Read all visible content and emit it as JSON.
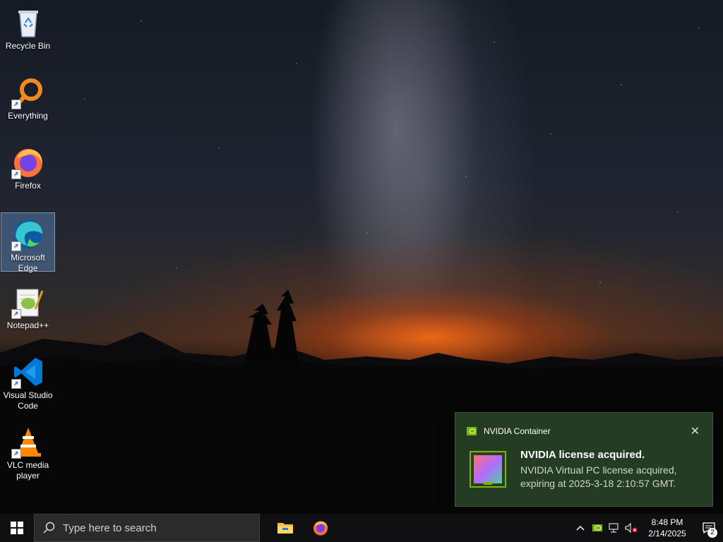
{
  "desktop_icons": [
    {
      "label": "Recycle Bin",
      "icon": "recycle-bin-icon"
    },
    {
      "label": "Everything",
      "icon": "everything-search-icon"
    },
    {
      "label": "Firefox",
      "icon": "firefox-icon"
    },
    {
      "label": "Microsoft Edge",
      "icon": "edge-icon"
    },
    {
      "label": "Notepad++",
      "icon": "notepad-plus-plus-icon"
    },
    {
      "label": "Visual Studio Code",
      "icon": "vscode-icon"
    },
    {
      "label": "VLC media player",
      "icon": "vlc-icon"
    }
  ],
  "notification": {
    "app": "NVIDIA Container",
    "title": "NVIDIA license acquired.",
    "body": "NVIDIA Virtual PC license acquired, expiring at 2025-3-18 2:10:57 GMT.",
    "accent": "#76b900"
  },
  "taskbar": {
    "search_placeholder": "Type here to search",
    "pinned": [
      "file-explorer-icon",
      "firefox-icon"
    ],
    "clock_time": "8:48 PM",
    "clock_date": "2/14/2025",
    "notification_count": "2"
  },
  "colors": {
    "taskbar_bg": "#101012",
    "toast_bg": "#243b24",
    "selection": "#5a8cc8"
  }
}
